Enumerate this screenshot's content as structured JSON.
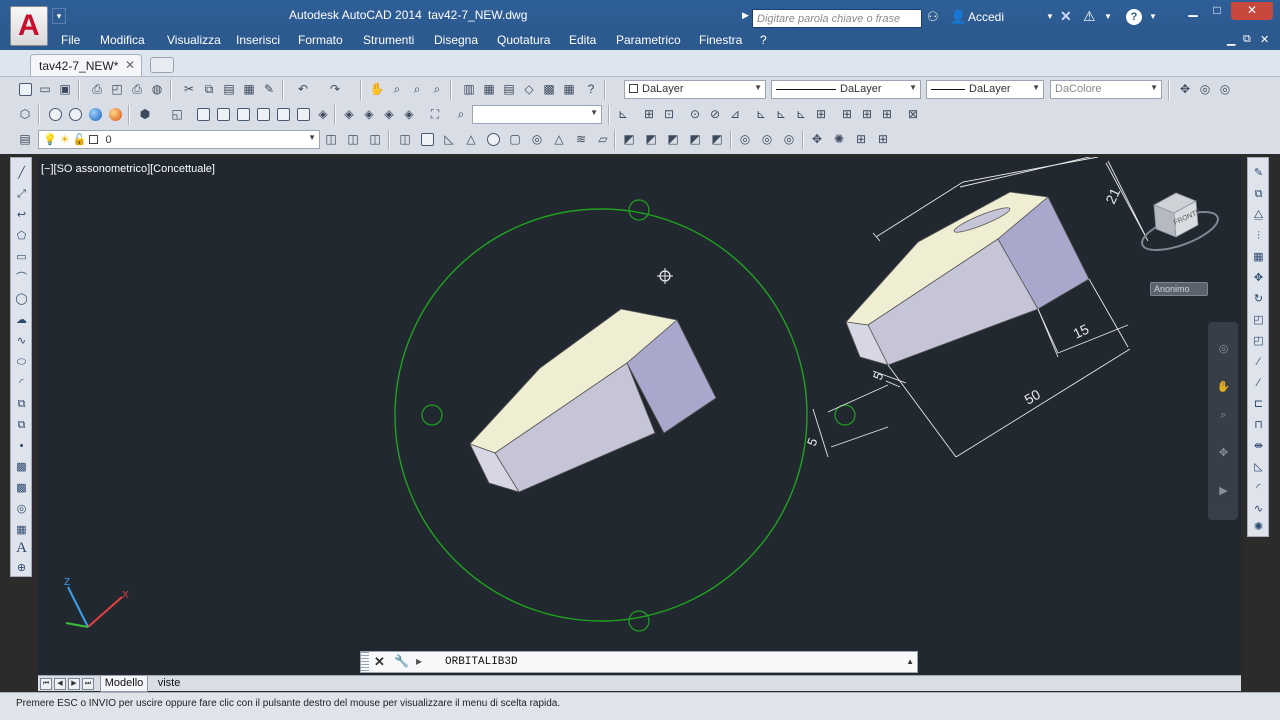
{
  "window": {
    "app_title": "Autodesk AutoCAD 2014",
    "doc_title": "tav42-7_NEW.dwg",
    "logo_letter": "A"
  },
  "search": {
    "placeholder": "Digitare parola chiave o frase"
  },
  "account": {
    "login_label": "Accedi"
  },
  "menu": [
    "File",
    "Modifica",
    "Visualizza",
    "Inserisci",
    "Formato",
    "Strumenti",
    "Disegna",
    "Quotatura",
    "Edita",
    "Parametrico",
    "Finestra",
    "?"
  ],
  "tabs": {
    "file_tab": "tav42-7_NEW*"
  },
  "toolbars": {
    "layer_combo": "DaLayer",
    "linetype_combo": "DaLayer",
    "lineweight_combo": "DaLayer",
    "color_combo": "DaColore",
    "current_layer": "0"
  },
  "viewport": {
    "label": "[−][SO assonometrico][Concettuale]",
    "viewcube_face": "FRONTE",
    "viewcube_menu": "Anonimo"
  },
  "dimensions": {
    "d21": "21",
    "d15": "15",
    "d50": "50",
    "d5a": "5",
    "d5b": "5"
  },
  "command": {
    "text": "ORBITALIB3D"
  },
  "layout_tabs": {
    "model": "Modello",
    "views": "viste"
  },
  "status": {
    "message": "Premere ESC o INVIO per uscire oppure fare clic con il pulsante destro del mouse per visualizzare il menu di scelta rapida."
  },
  "colors": {
    "title_bar": "#2c5a8f",
    "drawing_bg": "#212830",
    "orbit_circle": "#1fa31f",
    "solid_top": "#efeed2",
    "solid_side": "#a9a8cc"
  }
}
